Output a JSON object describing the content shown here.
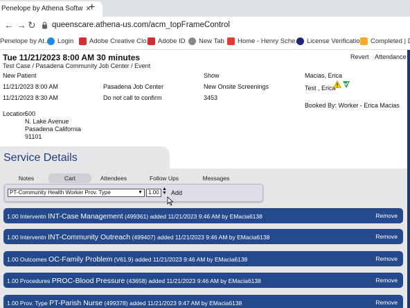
{
  "browser": {
    "tab_title": "Penelope by Athena Softw...",
    "tab_close": "×",
    "new_tab": "+",
    "url": "queenscare.athena-us.com/acm_topFrameControl",
    "bookmarks": [
      {
        "label": "Penelope by At...",
        "icon_color": "#4a6fb0"
      },
      {
        "label": "Login",
        "icon_color": "#1e88e5"
      },
      {
        "label": "Adobe Creative Clo...",
        "icon_color": "#d32f2f"
      },
      {
        "label": "Adobe ID",
        "icon_color": "#d32f2f"
      },
      {
        "label": "New Tab",
        "icon_color": "#777777"
      },
      {
        "label": "Home - Henry Sche...",
        "icon_color": "#e53935"
      },
      {
        "label": "License Verification",
        "icon_color": "#1a237e"
      },
      {
        "label": "Completed | Do",
        "icon_color": "#f9a825"
      }
    ]
  },
  "header": {
    "title": "Tue 11/21/2023 8:00 AM  30 minutes",
    "subtitle": "Test Case / Pasadena Community Job Center / Event",
    "revert": "Revert",
    "attendance": "Attendance"
  },
  "details": {
    "new_patient": "New Patient",
    "time1": "11/21/2023 8:00 AM",
    "time2": "11/21/2023 8:30 AM",
    "center": "Pasadena Job Center",
    "do_not_call": "Do not call to confirm",
    "show_label": "Show",
    "show_value": "New Onsite Screenings",
    "number": "3453",
    "worker": "Macias, Erica",
    "client": "Test , Erica",
    "booked_by": "Booked By: Worker - Erica  Macias",
    "location_label": "Location",
    "address": [
      "500",
      "N. Lake Avenue",
      "Pasadena California",
      "91101"
    ]
  },
  "service": {
    "title": "Service Details",
    "tabs": [
      "Notes",
      "Cart",
      "Attendees",
      "Follow Ups",
      "Messages"
    ],
    "active_tab": "Cart",
    "select_value": "PT-Community Health Worker Prov. Type",
    "qty": "1.00",
    "add_label": "Add",
    "rows": [
      {
        "qty": "1.00",
        "type": "Interventn",
        "code": "INT-Case Management",
        "id": "(499361)",
        "detail": "added 11/21/2023 9:46 AM by EMacia6138",
        "remove": "Remove"
      },
      {
        "qty": "1.00",
        "type": "Interventn",
        "code": "INT-Community Outreach",
        "id": "(499407)",
        "detail": "added 11/21/2023 9:46 AM by EMacia6138",
        "remove": "Remove"
      },
      {
        "qty": "1.00",
        "type": "Outcomes",
        "code": "OC-Family Problem",
        "id": "(V61.9)",
        "detail": "added 11/21/2023 9:46 AM by EMacia6138",
        "remove": "Remove"
      },
      {
        "qty": "1.00",
        "type": "Procedures",
        "code": "PROC-Blood Pressure",
        "id": "(43658)",
        "detail": "added 11/21/2023 9:46 AM by EMacia6138",
        "remove": "Remove"
      },
      {
        "qty": "1.00",
        "type": "Prov. Type",
        "code": "PT-Parish Nurse",
        "id": "(499378)",
        "detail": "added 11/21/2023 9:47 AM by EMacia6138",
        "remove": "Remove"
      }
    ]
  },
  "colors": {
    "accent": "#24498c",
    "title_blue": "#1f3e7a"
  }
}
